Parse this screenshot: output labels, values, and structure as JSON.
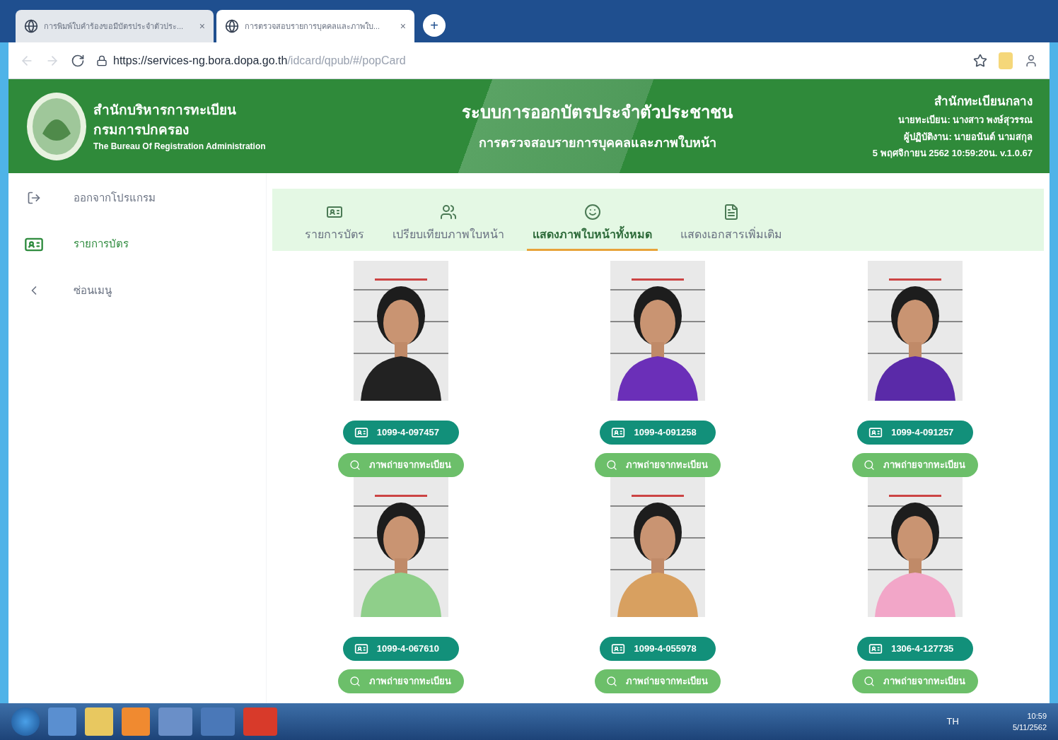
{
  "browser": {
    "tabs": [
      {
        "title": "การพิมพ์ใบคำร้องขอมีบัตรประจำตัวประ...",
        "selected": false,
        "close": "×"
      },
      {
        "title": "การตรวจสอบรายการบุคคลและภาพใบ...",
        "selected": true,
        "close": "×"
      }
    ],
    "new_tab": "+",
    "url_host": "https://services-ng.bora.dopa.go.th",
    "url_path": "/idcard/qpub/#/popCard"
  },
  "header": {
    "org_lines": [
      "สำนักบริหารการทะเบียน",
      "กรมการปกครอง"
    ],
    "org_english": "The Bureau Of Registration Administration",
    "title": "ระบบการออกบัตรประจำตัวประชาชน",
    "subtitle": "การตรวจสอบรายการบุคคลและภาพใบหน้า",
    "info": [
      "สำนักทะเบียนกลาง",
      "นายทะเบียน: นางสาว พงษ์สุวรรณ",
      "ผู้ปฏิบัติงาน: นายอนันต์ นามสกุล",
      "5 พฤศจิกายน 2562 10:59:20น.  v.1.0.67"
    ]
  },
  "sidebar": {
    "items": [
      {
        "kind": "exit",
        "label": "ออกจากโปรแกรม",
        "selected": false
      },
      {
        "kind": "card",
        "label": "รายการบัตร",
        "selected": true
      },
      {
        "kind": "collapse",
        "label": "ซ่อนเมนู",
        "selected": false
      }
    ]
  },
  "tabs": [
    {
      "kind": "card",
      "label": "รายการบัตร",
      "selected": false
    },
    {
      "kind": "compare",
      "label": "เปรียบเทียบภาพใบหน้า",
      "selected": false
    },
    {
      "kind": "face",
      "label": "แสดงภาพใบหน้าทั้งหมด",
      "selected": true
    },
    {
      "kind": "document",
      "label": "แสดงเอกสารเพิ่มเติม",
      "selected": false
    }
  ],
  "cards": [
    {
      "kind": "picture",
      "card_number": "1099-4-097457",
      "action": "ภาพถ่ายจากทะเบียน"
    },
    {
      "kind": "picture",
      "card_number": "1099-4-091258",
      "action": "ภาพถ่ายจากทะเบียน"
    },
    {
      "kind": "picture",
      "card_number": "1099-4-091257",
      "action": "ภาพถ่ายจากทะเบียน"
    },
    {
      "kind": "picture",
      "card_number": "1099-4-067610",
      "action": "ภาพถ่ายจากทะเบียน"
    },
    {
      "kind": "picture",
      "card_number": "1099-4-055978",
      "action": "ภาพถ่ายจากทะเบียน"
    },
    {
      "kind": "picture",
      "card_number": "1306-4-127735",
      "action": "ภาพถ่ายจากทะเบียน"
    }
  ],
  "taskbar": {
    "language": "TH",
    "time": "10:59",
    "date": "5/11/2562"
  }
}
